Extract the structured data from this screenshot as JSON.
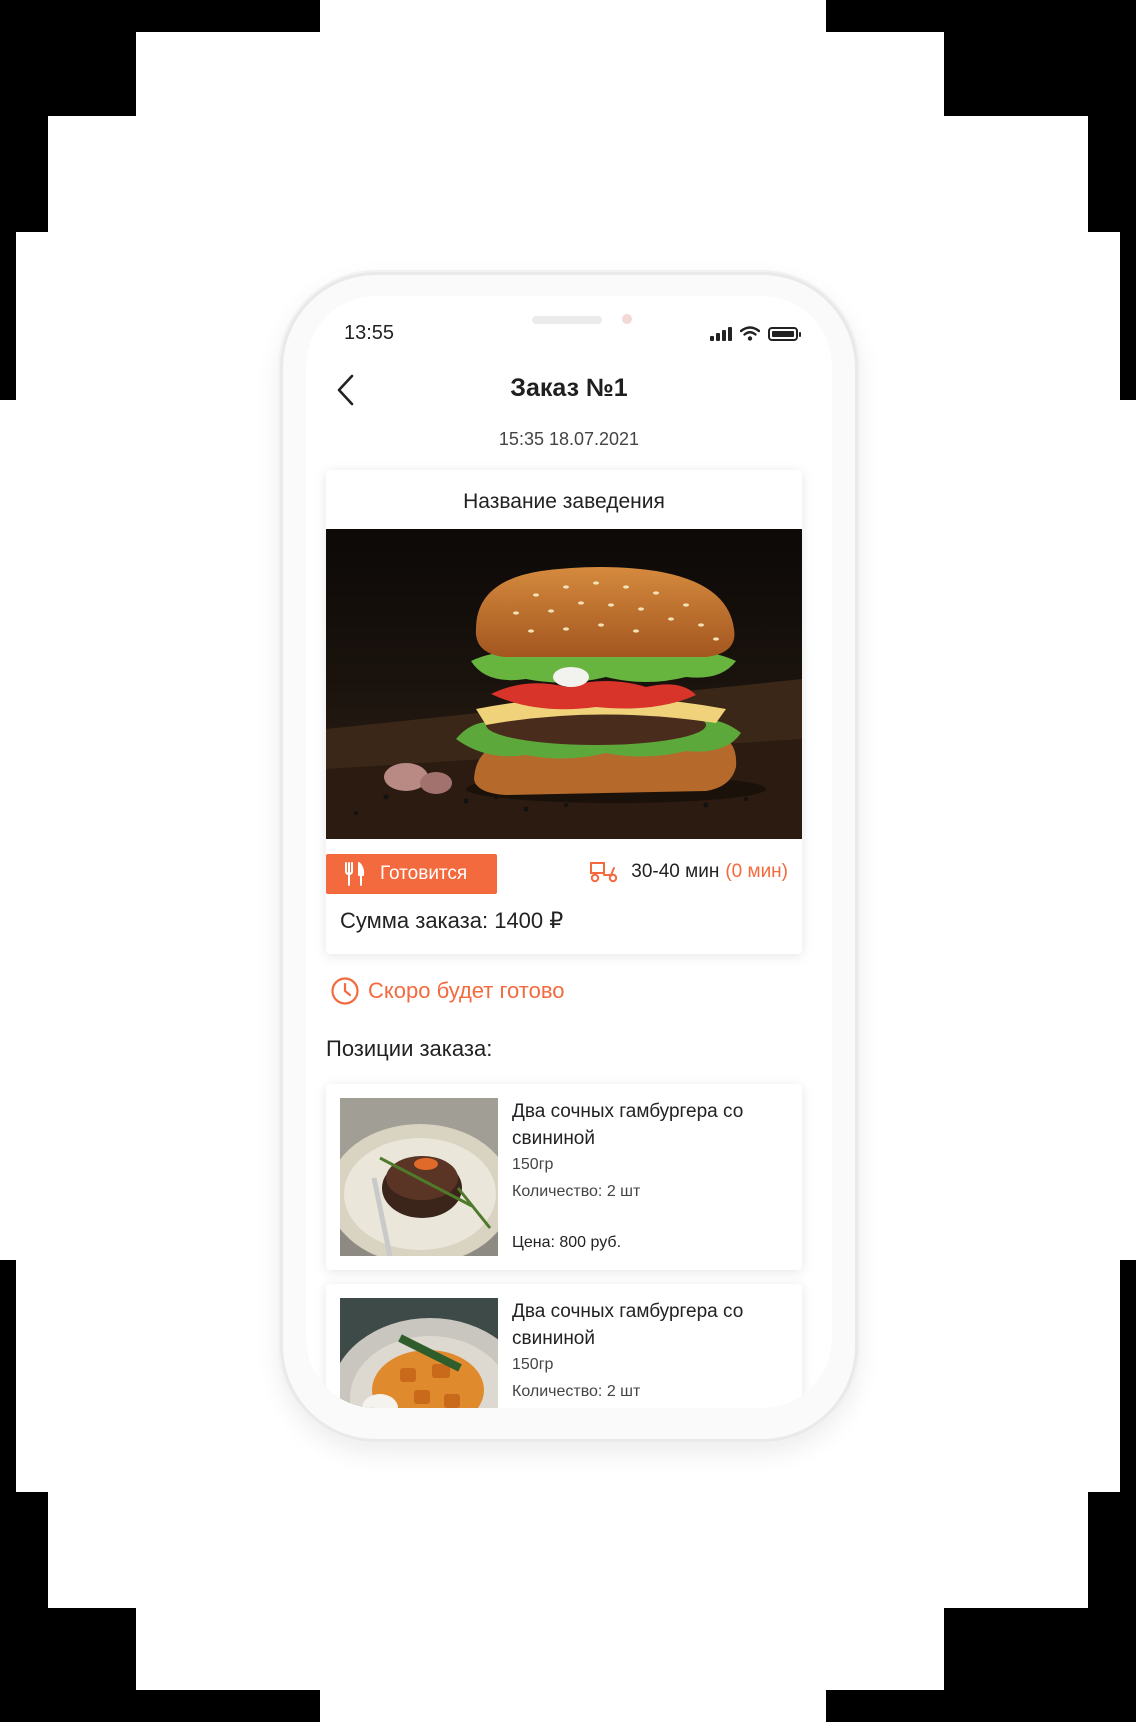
{
  "status_bar": {
    "time": "13:55"
  },
  "header": {
    "title": "Заказ №1",
    "datetime": "15:35 18.07.2021"
  },
  "venue": {
    "name": "Название заведения",
    "status": "Готовится",
    "delivery_time": "30-40 мин",
    "delay": "(0 мин)",
    "total_label": "Сумма заказа: 1400 ₽"
  },
  "notice": "Скоро будет готово",
  "positions_title": "Позиции заказа:",
  "items": [
    {
      "title": "Два сочных гамбургера со свининой",
      "weight": "150гр",
      "quantity": "Количество: 2 шт",
      "price": "Цена: 800 руб."
    },
    {
      "title": "Два сочных гамбургера со свининой",
      "weight": "150гр",
      "quantity": "Количество: 2 шт"
    }
  ],
  "colors": {
    "accent": "#f36a3e",
    "text": "#1f1f1f"
  },
  "icons": [
    "back-arrow-icon",
    "signal-icon",
    "wifi-icon",
    "battery-icon",
    "fork-knife-icon",
    "delivery-scooter-icon",
    "clock-icon"
  ]
}
